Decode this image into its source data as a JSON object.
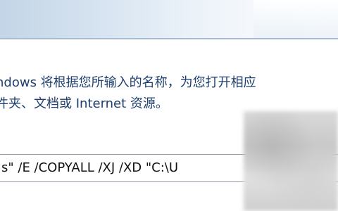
{
  "dialog": {
    "description_line1": "ndows 将根据您所输入的名称，为您打开相应",
    "description_line2": "件夹、文档或 Internet 资源。",
    "command_value": "s\" /E /COPYALL /XJ /XD \"C:\\U"
  }
}
